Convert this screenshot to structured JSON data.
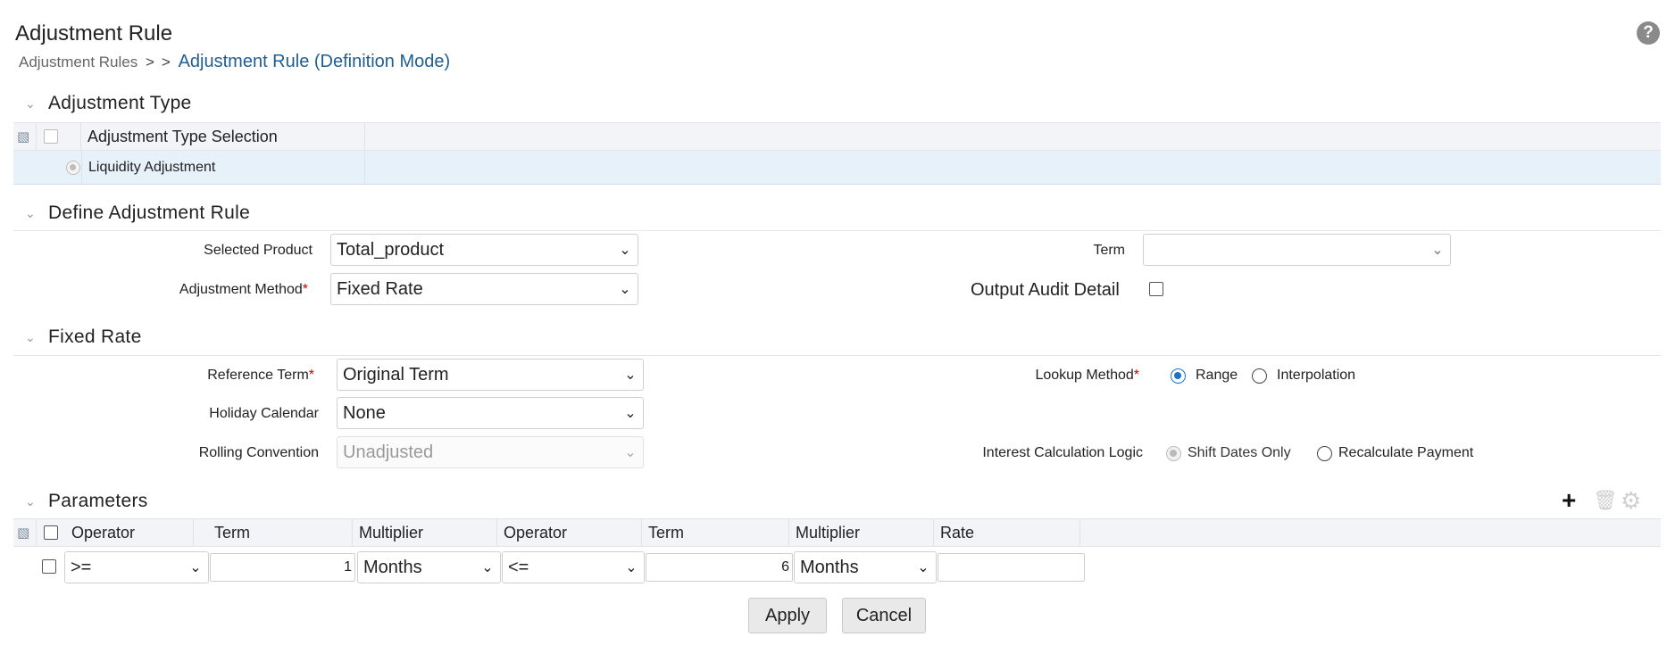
{
  "header": {
    "title": "Adjustment Rule",
    "help_icon": "help-icon",
    "breadcrumb": {
      "root": "Adjustment Rules",
      "sep1": ">",
      "sep2": ">",
      "current": "Adjustment Rule (Definition Mode)"
    }
  },
  "adjustment_type": {
    "title": "Adjustment Type",
    "column_header": "Adjustment Type Selection",
    "rows": [
      {
        "label": "Liquidity Adjustment",
        "selected": true
      }
    ]
  },
  "define_rule": {
    "title": "Define Adjustment Rule",
    "selected_product_label": "Selected Product",
    "selected_product_value": "Total_product",
    "term_label": "Term",
    "term_value": "",
    "adjustment_method_label": "Adjustment Method",
    "adjustment_method_value": "Fixed Rate",
    "required_mark": "*",
    "output_audit_label": "Output Audit Detail"
  },
  "fixed_rate": {
    "title": "Fixed Rate",
    "reference_term_label": "Reference Term",
    "reference_term_value": "Original Term",
    "holiday_calendar_label": "Holiday Calendar",
    "holiday_calendar_value": "None",
    "rolling_convention_label": "Rolling Convention",
    "rolling_convention_value": "Unadjusted",
    "lookup_method_label": "Lookup Method",
    "lookup_options": [
      "Range",
      "Interpolation"
    ],
    "lookup_selected": "Range",
    "interest_calc_label": "Interest Calculation Logic",
    "interest_options": [
      "Shift Dates Only",
      "Recalculate Payment"
    ],
    "interest_selected": "Shift Dates Only"
  },
  "parameters": {
    "title": "Parameters",
    "columns": [
      "Operator",
      "Term",
      "Multiplier",
      "Operator",
      "Term",
      "Multiplier",
      "Rate"
    ],
    "row": {
      "operator1": ">=",
      "term1": "1",
      "multiplier1": "Months",
      "operator2": "<=",
      "term2": "6",
      "multiplier2": "Months",
      "rate": ""
    }
  },
  "buttons": {
    "apply": "Apply",
    "cancel": "Cancel"
  },
  "icons": {
    "add": "plus-icon",
    "delete": "trash-icon",
    "settings": "gear-icon",
    "tree": "hierarchy-icon",
    "chevron": "chevron-down-icon"
  },
  "colors": {
    "link": "#1f5e92",
    "selected_row": "#e7f1fa",
    "radio_on": "#1a73c8",
    "required": "#cc0000"
  }
}
